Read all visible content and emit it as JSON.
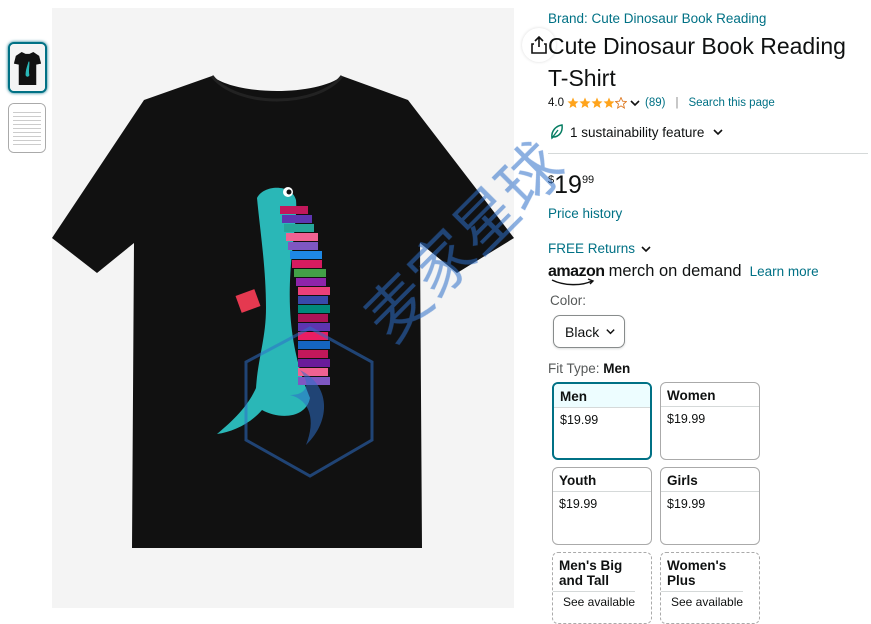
{
  "product": {
    "brand_link": "Brand: Cute Dinosaur Book Reading",
    "title": "Cute Dinosaur Book Reading T-Shirt",
    "rating_value": "4.0",
    "rating_stars": 4,
    "rating_count": "(89)",
    "search_link": "Search this page",
    "sustainability": "1 sustainability feature",
    "price_symbol": "$",
    "price_whole": "19",
    "price_fraction": "99",
    "price_history": "Price history",
    "free_returns": "FREE Returns",
    "merch_brand": "amazon",
    "merch_text": "merch on demand",
    "learn_more": "Learn more"
  },
  "color": {
    "label": "Color:",
    "selected": "Black"
  },
  "fit": {
    "label": "Fit Type:",
    "selected": "Men",
    "options": [
      {
        "name": "Men",
        "price": "$19.99"
      },
      {
        "name": "Women",
        "price": "$19.99"
      },
      {
        "name": "Youth",
        "price": "$19.99"
      },
      {
        "name": "Girls",
        "price": "$19.99"
      },
      {
        "name": "Men's Big and Tall",
        "note": "See available"
      },
      {
        "name": "Women's Plus",
        "note": "See available"
      }
    ]
  },
  "watermark": "麦家星球",
  "colors": {
    "link": "#007185",
    "star": "#ffa41c",
    "shirt": "#111111",
    "dino": "#2ab7b7"
  }
}
